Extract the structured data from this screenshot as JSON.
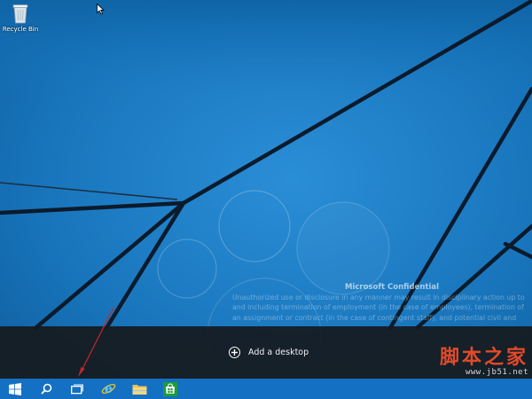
{
  "desktop": {
    "icons": [
      {
        "label": "Recycle Bin",
        "icon": "recycle-bin-icon"
      }
    ]
  },
  "watermark_text": {
    "title": "Microsoft Confidential",
    "lines": [
      "Unauthorized use or disclosure in any manner may result in disciplinary action up to",
      "and including termination of employment (in the case of employees), termination of",
      "an assignment or contract (in the case of contingent staff), and potential civil and"
    ]
  },
  "task_view": {
    "add_desktop_label": "Add a desktop"
  },
  "taskbar": {
    "buttons": [
      {
        "name": "start",
        "icon": "windows-logo-icon"
      },
      {
        "name": "search",
        "icon": "search-icon"
      },
      {
        "name": "task-view",
        "icon": "task-view-icon"
      },
      {
        "name": "internet-explorer",
        "icon": "internet-explorer-icon"
      },
      {
        "name": "file-explorer",
        "icon": "folder-icon"
      },
      {
        "name": "store",
        "icon": "store-icon"
      }
    ]
  },
  "site_watermark": {
    "title": "脚本之家",
    "url": "www.jb51.net"
  },
  "colors": {
    "wallpaper_blue": "#1a73b8",
    "taskbar_blue": "#1470c2",
    "task_view_bar": "#16191e",
    "annotation_arrow": "#c0282b",
    "watermark_red": "#e24a2a"
  }
}
